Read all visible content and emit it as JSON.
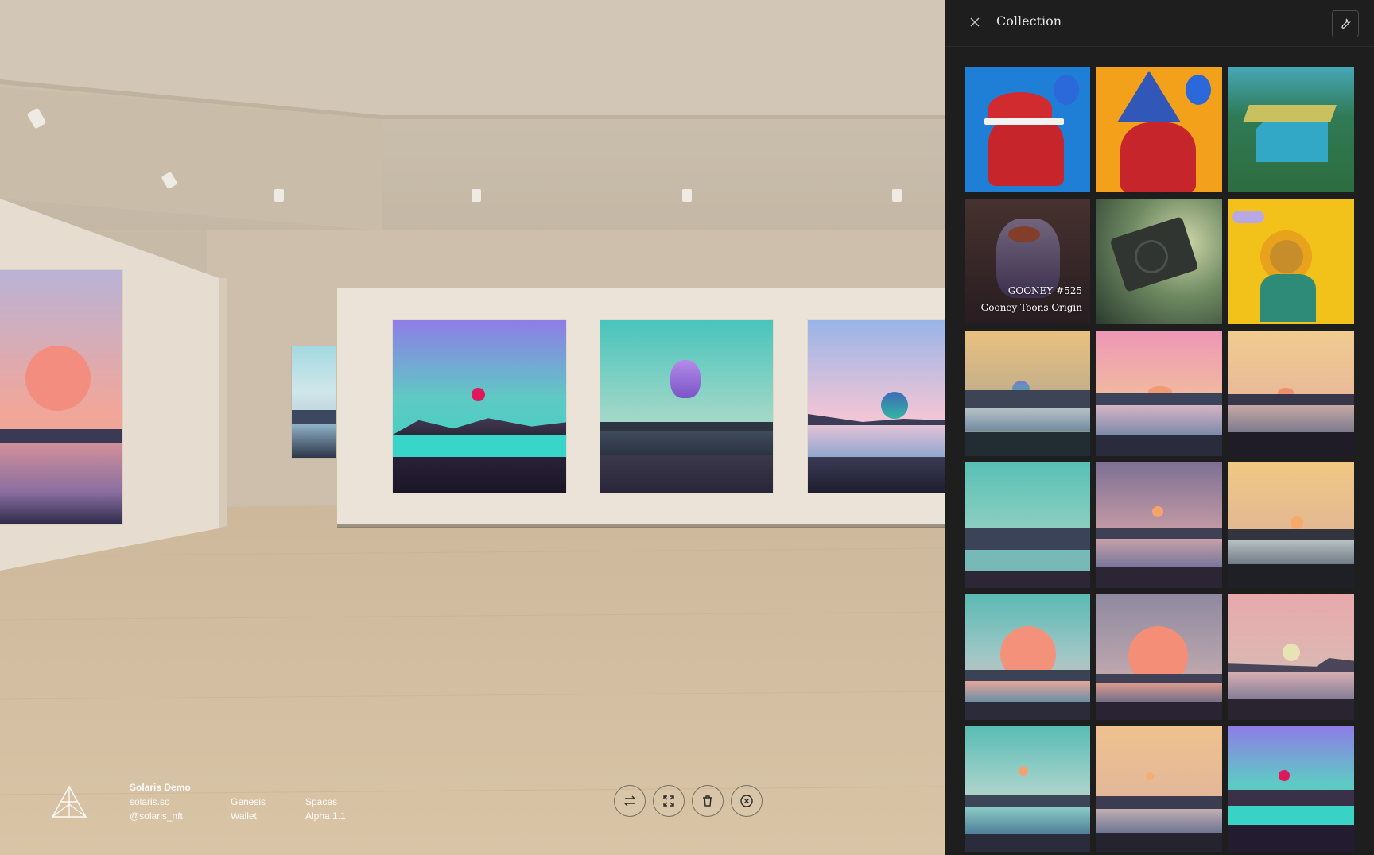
{
  "panel": {
    "title": "Collection",
    "icons": {
      "close": "close-icon",
      "tool": "wrench-icon"
    },
    "tiles": [
      {
        "kind": "pixel-cat-santa",
        "caption_name": "",
        "caption_collection": ""
      },
      {
        "kind": "pixel-cat-wizard",
        "caption_name": "",
        "caption_collection": ""
      },
      {
        "kind": "pixel-forest-house",
        "caption_name": "",
        "caption_collection": ""
      },
      {
        "kind": "gooney",
        "caption_name": "GOONEY #525",
        "caption_collection": "Gooney Toons Origin"
      },
      {
        "kind": "genesis-card",
        "caption_name": "",
        "caption_collection": ""
      },
      {
        "kind": "sunflower",
        "caption_name": "",
        "caption_collection": ""
      },
      {
        "kind": "landscape-1",
        "caption_name": "",
        "caption_collection": ""
      },
      {
        "kind": "landscape-2",
        "caption_name": "",
        "caption_collection": ""
      },
      {
        "kind": "landscape-3",
        "caption_name": "",
        "caption_collection": ""
      },
      {
        "kind": "landscape-4",
        "caption_name": "",
        "caption_collection": ""
      },
      {
        "kind": "landscape-5",
        "caption_name": "",
        "caption_collection": ""
      },
      {
        "kind": "landscape-6",
        "caption_name": "",
        "caption_collection": ""
      },
      {
        "kind": "landscape-7",
        "caption_name": "",
        "caption_collection": ""
      },
      {
        "kind": "landscape-8",
        "caption_name": "",
        "caption_collection": ""
      },
      {
        "kind": "landscape-9",
        "caption_name": "",
        "caption_collection": ""
      },
      {
        "kind": "landscape-10",
        "caption_name": "",
        "caption_collection": ""
      },
      {
        "kind": "landscape-11",
        "caption_name": "",
        "caption_collection": ""
      },
      {
        "kind": "landscape-12",
        "caption_name": "",
        "caption_collection": ""
      }
    ]
  },
  "footer": {
    "logo": "solaris-logo-icon",
    "name": "Solaris Demo",
    "site": "solaris.so",
    "handle": "@solaris_nft",
    "genesis": "Genesis",
    "wallet": "Wallet",
    "spaces": "Spaces",
    "version": "Alpha 1.1"
  },
  "controls": [
    {
      "name": "swap-button",
      "icon": "swap-icon"
    },
    {
      "name": "fullscreen-button",
      "icon": "expand-icon"
    },
    {
      "name": "delete-button",
      "icon": "trash-icon"
    },
    {
      "name": "remove-button",
      "icon": "close-circle-icon"
    }
  ],
  "colors": {
    "panel_bg": "#1e1e1e",
    "wall": "#ede6da",
    "floor": "#d8c3a4"
  }
}
